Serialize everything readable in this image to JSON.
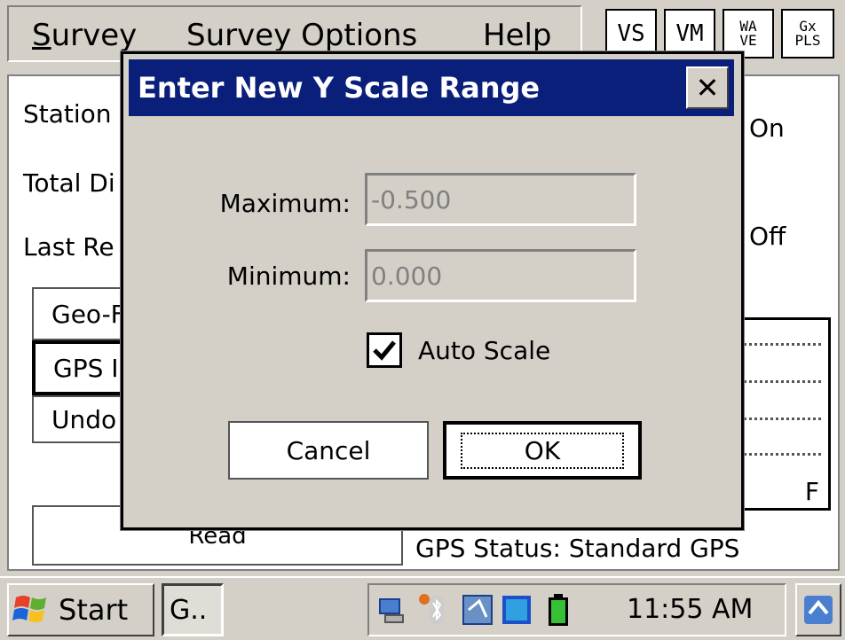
{
  "menu": {
    "items": [
      "Survey",
      "Survey Options",
      "Help"
    ],
    "tool_buttons": [
      "VS",
      "VM",
      "WA\nVE",
      "Gx\nPLS"
    ]
  },
  "background": {
    "labels": {
      "station": "Station",
      "total": "Total Di",
      "last": "Last Re",
      "on": "On",
      "off": "Off"
    },
    "buttons": [
      "Geo-F",
      "GPS I",
      "Undo"
    ],
    "read_button": "Read",
    "gps_status": "GPS Status: Standard GPS",
    "graph_label": "F"
  },
  "dialog": {
    "title": "Enter New Y Scale Range",
    "close_label": "✕",
    "maximum_label": "Maximum:",
    "maximum_value": "-0.500",
    "minimum_label": "Minimum:",
    "minimum_value": "0.000",
    "auto_scale_label": "Auto Scale",
    "auto_scale_checked": true,
    "cancel_label": "Cancel",
    "ok_label": "OK"
  },
  "taskbar": {
    "start_label": "Start",
    "task_label": "G..",
    "clock": "11:55 AM"
  },
  "colors": {
    "titlebar": "#0a1f7a",
    "chrome": "#d4d0c8"
  }
}
